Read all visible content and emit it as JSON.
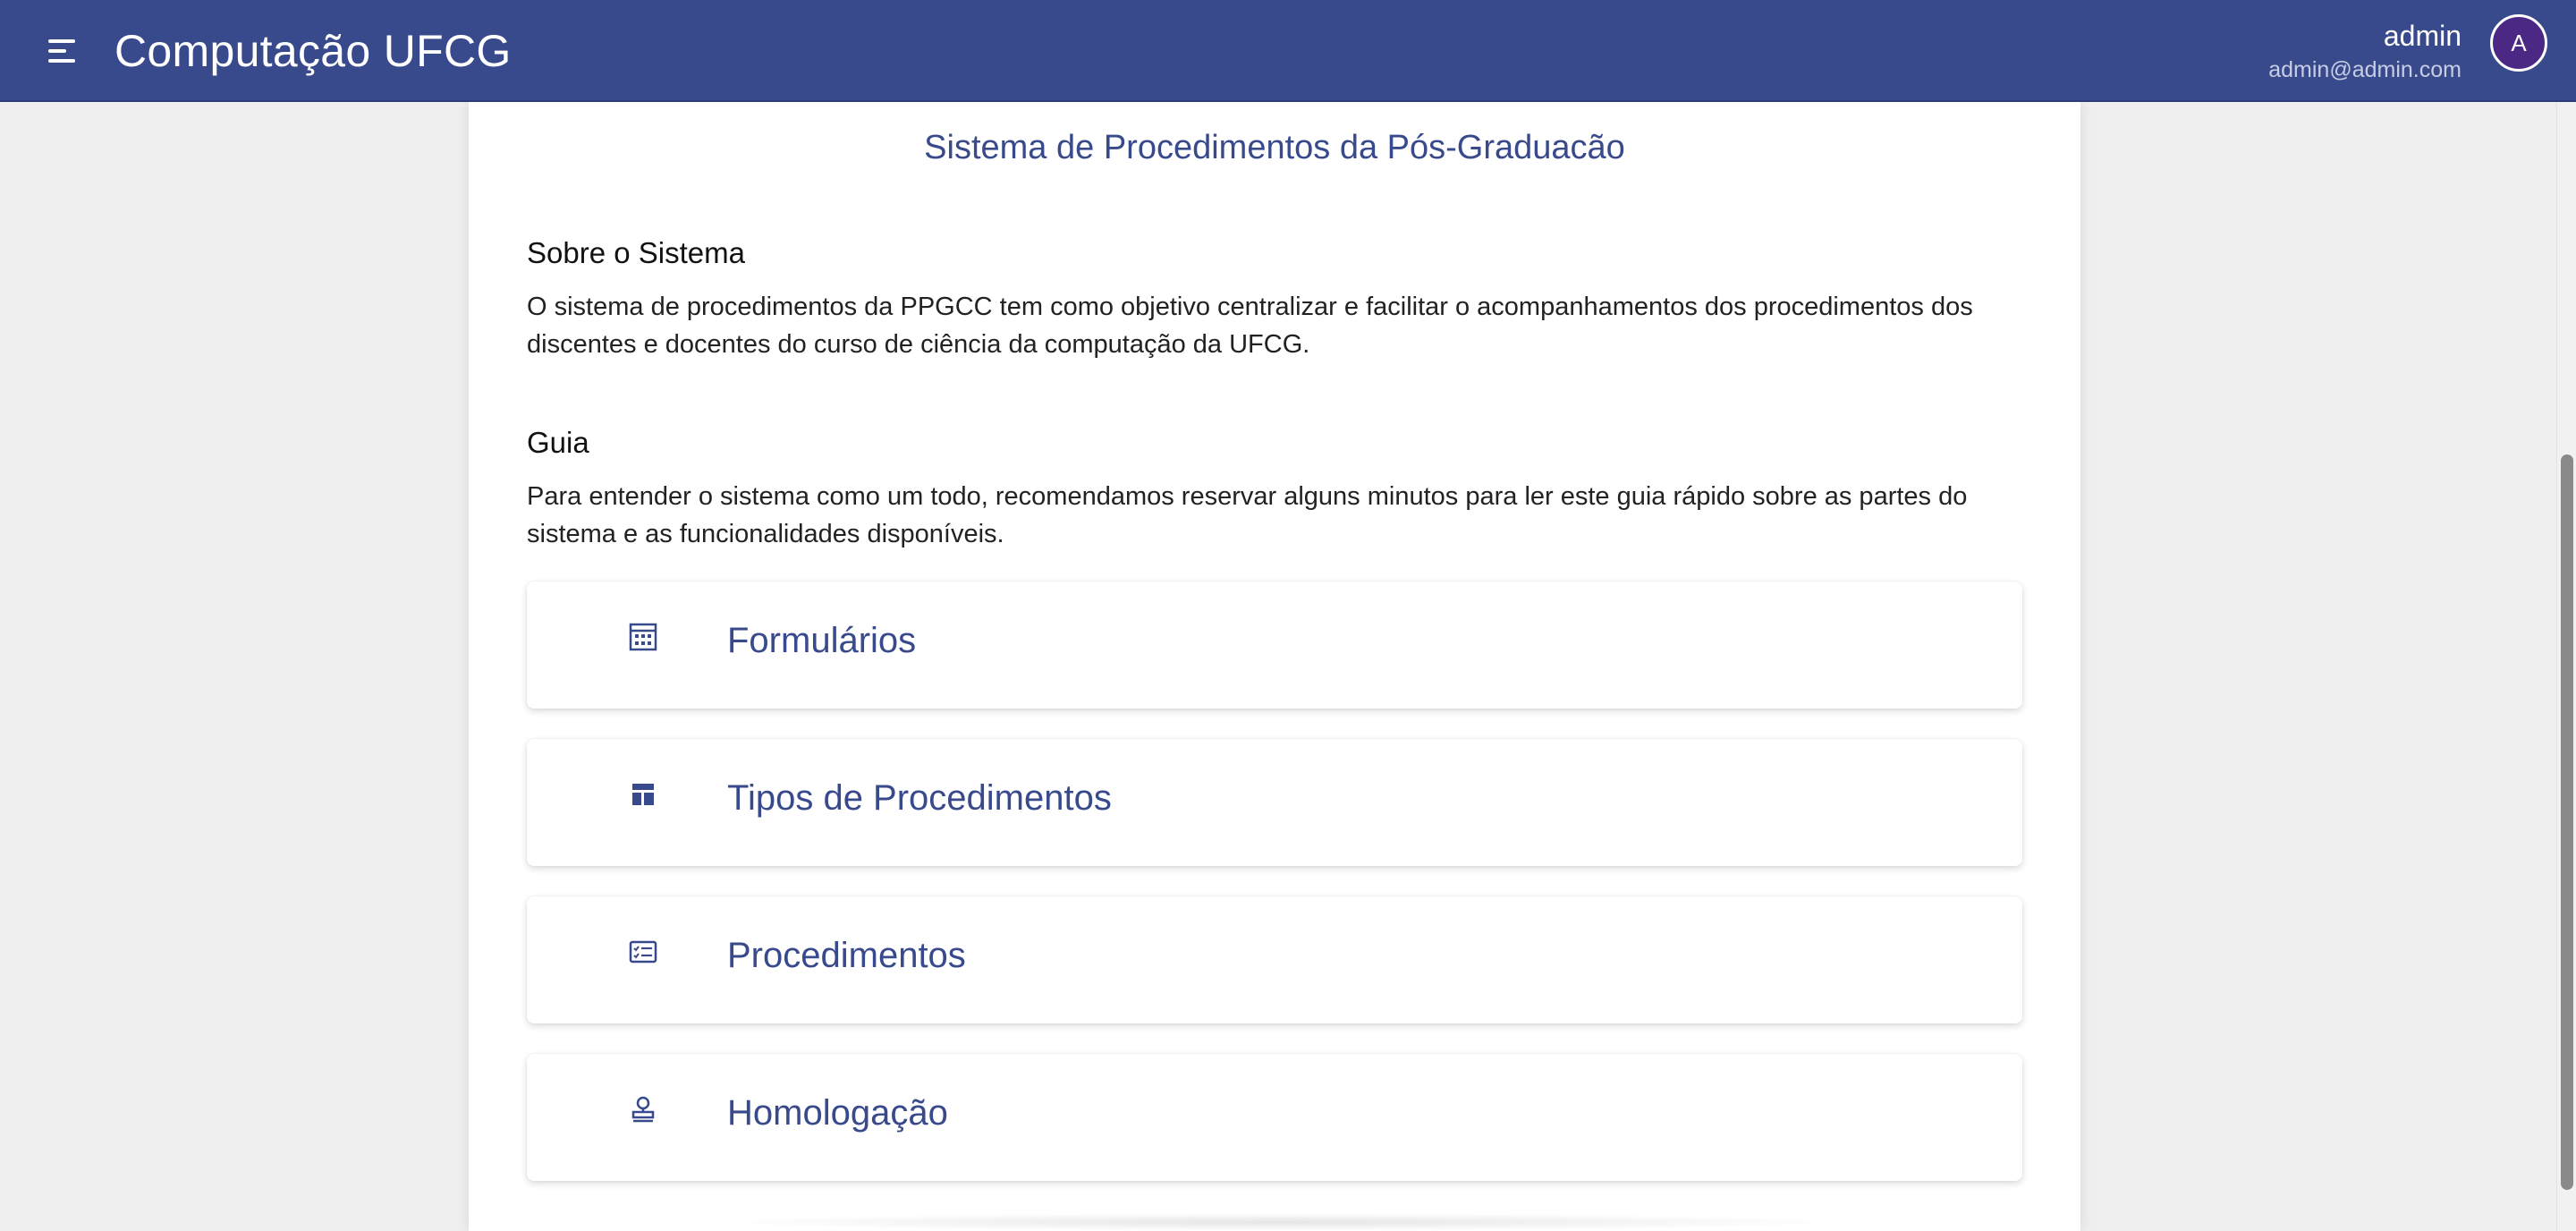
{
  "header": {
    "app_title": "Computação UFCG",
    "user_name": "admin",
    "user_email": "admin@admin.com",
    "avatar_letter": "A",
    "bar_color": "#394a8c",
    "avatar_color": "#4b2883"
  },
  "main": {
    "title": "Sistema de Procedimentos da Pós-Graduacão",
    "about": {
      "heading": "Sobre o Sistema",
      "text": "O sistema de procedimentos da PPGCC tem como objetivo centralizar e facilitar o acompanhamentos dos procedimentos dos discentes e docentes do curso de ciência da computação da UFCG."
    },
    "guide": {
      "heading": "Guia",
      "text": "Para entender o sistema como um todo, recomendamos reservar alguns minutos para ler este guia rápido sobre as partes do sistema e as funcionalidades disponíveis.",
      "items": [
        {
          "label": "Formulários",
          "icon": "form-grid-icon"
        },
        {
          "label": "Tipos de Procedimentos",
          "icon": "dashboard-icon"
        },
        {
          "label": "Procedimentos",
          "icon": "checklist-card-icon"
        },
        {
          "label": "Homologação",
          "icon": "stamp-icon"
        }
      ]
    }
  }
}
